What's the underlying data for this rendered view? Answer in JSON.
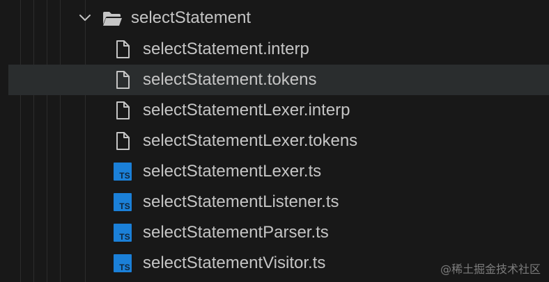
{
  "folder": {
    "name": "selectStatement",
    "expanded": true
  },
  "files": [
    {
      "name": "selectStatement.interp",
      "icon": "file-icon",
      "selected": false
    },
    {
      "name": "selectStatement.tokens",
      "icon": "file-icon",
      "selected": true
    },
    {
      "name": "selectStatementLexer.interp",
      "icon": "file-icon",
      "selected": false
    },
    {
      "name": "selectStatementLexer.tokens",
      "icon": "file-icon",
      "selected": false
    },
    {
      "name": "selectStatementLexer.ts",
      "icon": "typescript-icon",
      "selected": false
    },
    {
      "name": "selectStatementListener.ts",
      "icon": "typescript-icon",
      "selected": false
    },
    {
      "name": "selectStatementParser.ts",
      "icon": "typescript-icon",
      "selected": false
    },
    {
      "name": "selectStatementVisitor.ts",
      "icon": "typescript-icon",
      "selected": false
    }
  ],
  "ts_icon_text": "TS",
  "watermark": "@稀土掘金技术社区",
  "colors": {
    "background": "#181818",
    "selected_row": "#2a2d2e",
    "text": "#c5c5c5",
    "ts_icon": "#1b80d8"
  }
}
